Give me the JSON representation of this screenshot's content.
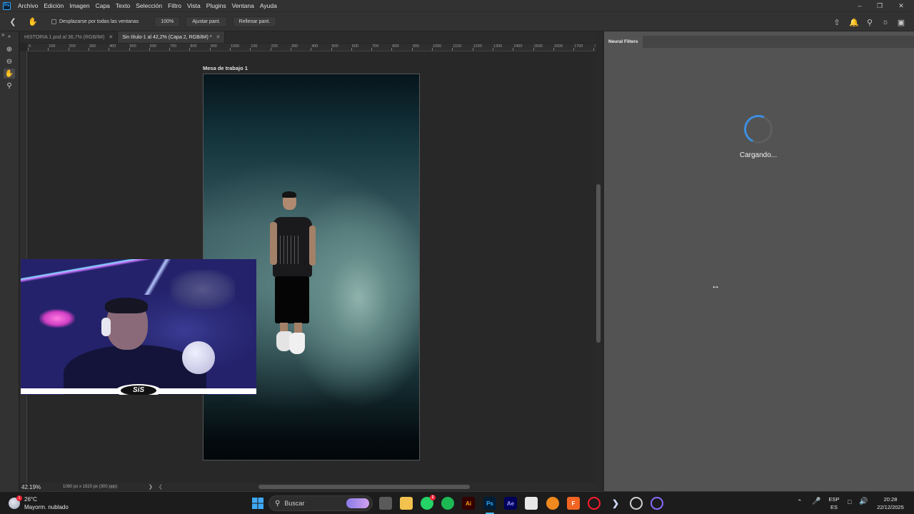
{
  "menubar": {
    "app_icon": "Ps",
    "items": [
      "Archivo",
      "Edición",
      "Imagen",
      "Capa",
      "Texto",
      "Selección",
      "Filtro",
      "Vista",
      "Plugins",
      "Ventana",
      "Ayuda"
    ]
  },
  "options": {
    "scroll_all_label": "Desplazarse por todas las ventanas",
    "zoom_100": "100%",
    "fit_screen": "Ajustar pant.",
    "fill_screen": "Rellenar pant."
  },
  "tabs": [
    {
      "label": "HISTORIA 1.psd al 36,7% (RGB/8#)",
      "active": false
    },
    {
      "label": "Sin título-1 al 42,2% (Capa 2, RGB/8#) *",
      "active": true
    }
  ],
  "ruler_top": [
    "0",
    "100",
    "200",
    "300",
    "400",
    "500",
    "600",
    "700",
    "800",
    "900",
    "1000",
    "100",
    "200",
    "300",
    "400",
    "500",
    "600",
    "700",
    "800",
    "900",
    "1000",
    "1100",
    "1200",
    "1300",
    "1400",
    "1500",
    "1600",
    "1700",
    "1800",
    "1900"
  ],
  "artboard": {
    "title": "Mesa de trabajo 1"
  },
  "overlay": {
    "logo_text": "SiS"
  },
  "status": {
    "zoom": "42.19%",
    "doc_size": "1080 px x 1920 px (300 ppp)"
  },
  "panel": {
    "tab": "Neural Filters",
    "loading": "Cargando..."
  },
  "taskbar": {
    "weather_temp": "26°C",
    "weather_desc": "Mayorm. nublado",
    "weather_badge": "1",
    "search_placeholder": "Buscar",
    "whatsapp_badge": "2",
    "lang_top": "ESP",
    "lang_bottom": "ES",
    "time": "20:28",
    "date": "22/12/2025"
  },
  "colors": {
    "accent": "#31a8ff",
    "spinner": "#3d8fe0"
  }
}
